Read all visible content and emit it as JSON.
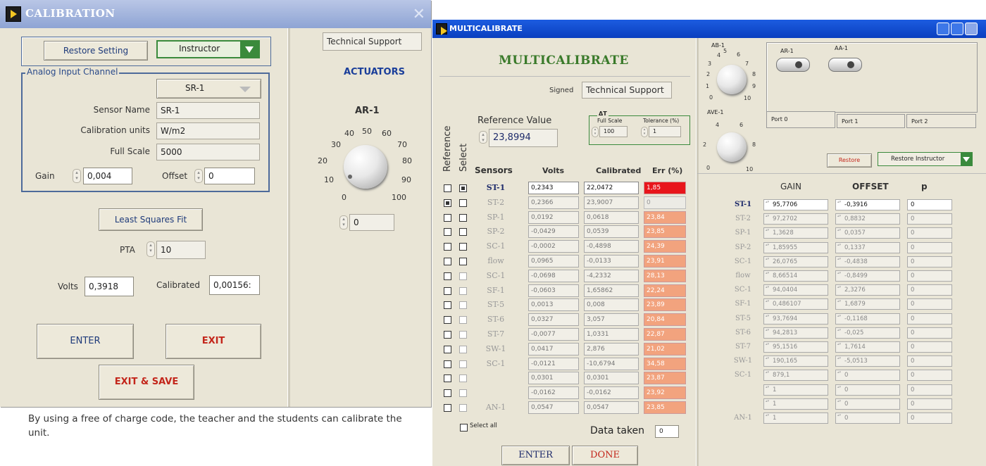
{
  "cal": {
    "title": "CALIBRATION",
    "restore_label": "Restore Setting",
    "instructor_value": "Instructor",
    "group_label": "Analog Input Channel",
    "channel_value": "SR-1",
    "sensor_name_label": "Sensor Name",
    "sensor_name_value": "SR-1",
    "cal_units_label": "Calibration units",
    "cal_units_value": "W/m2",
    "full_scale_label": "Full Scale",
    "full_scale_value": "5000",
    "gain_label": "Gain",
    "gain_value": "0,004",
    "offset_label": "Offset",
    "offset_value": "0",
    "lsq_label": "Least Squares  Fit",
    "pta_label": "PTA",
    "pta_value": "10",
    "volts_label": "Volts",
    "volts_value": "0,3918",
    "calibrated_label": "Calibrated",
    "calibrated_value": "0,00156:",
    "enter_label": "ENTER",
    "exit_label": "EXIT",
    "exit_save_label": "EXIT & SAVE",
    "tech_support_label": "Technical Support",
    "actuators_label": "ACTUATORS",
    "knob_label": "AR-1",
    "knob_ticks": [
      "0",
      "10",
      "20",
      "30",
      "40",
      "50",
      "60",
      "70",
      "80",
      "90",
      "100"
    ],
    "knob_value": "0"
  },
  "caption": "By using a free of charge code, the teacher and the students can calibrate the unit.",
  "multi": {
    "title": "MULTICALIBRATE",
    "heading": "MULTICALIBRATE",
    "signed_label": "Signed",
    "signed_value": "Technical Support",
    "ref_value_label": "Reference Value",
    "ref_value": "23,8994",
    "delta_t_label": "ΔT",
    "full_scale_label": "Full Scale",
    "full_scale_value": "100",
    "tolerance_label": "Tolerance (%)",
    "tolerance_value": "1",
    "col_reference": "Reference",
    "col_select": "Select",
    "col_sensors": "Sensors",
    "col_volts": "Volts",
    "col_calibrated": "Calibrated",
    "col_err": "Err (%)",
    "rows": [
      {
        "name": "ST-1",
        "volts": "0,2343",
        "cal": "22,0472",
        "err": "1,85",
        "ref": false,
        "sel": true,
        "active": true
      },
      {
        "name": "ST-2",
        "volts": "0,2366",
        "cal": "23,9007",
        "err": "0",
        "ref": true,
        "sel": false,
        "active": false
      },
      {
        "name": "SP-1",
        "volts": "0,0192",
        "cal": "0,0618",
        "err": "23,84",
        "ref": false,
        "sel": false,
        "active": false
      },
      {
        "name": "SP-2",
        "volts": "-0,0429",
        "cal": "0,0539",
        "err": "23,85",
        "ref": false,
        "sel": false,
        "active": false
      },
      {
        "name": "SC-1",
        "volts": "-0,0002",
        "cal": "-0,4898",
        "err": "24,39",
        "ref": false,
        "sel": false,
        "active": false
      },
      {
        "name": "flow",
        "volts": "0,0965",
        "cal": "-0,0133",
        "err": "23,91",
        "ref": false,
        "sel": false,
        "active": false
      },
      {
        "name": "SC-1",
        "volts": "-0,0698",
        "cal": "-4,2332",
        "err": "28,13",
        "ref": false,
        "sel": false,
        "active": false
      },
      {
        "name": "SF-1",
        "volts": "-0,0603",
        "cal": "1,65862",
        "err": "22,24",
        "ref": false,
        "sel": false,
        "active": false
      },
      {
        "name": "ST-5",
        "volts": "0,0013",
        "cal": "0,008",
        "err": "23,89",
        "ref": false,
        "sel": false,
        "active": false
      },
      {
        "name": "ST-6",
        "volts": "0,0327",
        "cal": "3,057",
        "err": "20,84",
        "ref": false,
        "sel": false,
        "active": false
      },
      {
        "name": "ST-7",
        "volts": "-0,0077",
        "cal": "1,0331",
        "err": "22,87",
        "ref": false,
        "sel": false,
        "active": false
      },
      {
        "name": "SW-1",
        "volts": "0,0417",
        "cal": "2,876",
        "err": "21,02",
        "ref": false,
        "sel": false,
        "active": false
      },
      {
        "name": "SC-1",
        "volts": "-0,0121",
        "cal": "-10,6794",
        "err": "34,58",
        "ref": false,
        "sel": false,
        "active": false
      },
      {
        "name": "",
        "volts": "0,0301",
        "cal": "0,0301",
        "err": "23,87",
        "ref": false,
        "sel": false,
        "active": false
      },
      {
        "name": "",
        "volts": "-0,0162",
        "cal": "-0,0162",
        "err": "23,92",
        "ref": false,
        "sel": false,
        "active": false
      },
      {
        "name": "AN-1",
        "volts": "0,0547",
        "cal": "0,0547",
        "err": "23,85",
        "ref": false,
        "sel": false,
        "active": false
      }
    ],
    "select_all_label": "Select all",
    "data_taken_label": "Data taken",
    "data_taken_value": "0",
    "enter_label": "ENTER",
    "done_label": "DONE",
    "ab_label": "AB-1",
    "ab_ticks": [
      "0",
      "1",
      "2",
      "3",
      "4",
      "5",
      "6",
      "7",
      "8",
      "9",
      "10"
    ],
    "ave_label": "AVE-1",
    "ave_ticks": [
      "0",
      "2",
      "4",
      "6",
      "8",
      "10"
    ],
    "ar_label": "AR-1",
    "aa_label": "AA-1",
    "ports": [
      "Port 0",
      "Port 1",
      "Port 2"
    ],
    "restore_label": "Restore",
    "restore_instructor_value": "Restore Instructor",
    "gain_header": "GAIN",
    "offset_header": "OFFSET",
    "p_header": "p",
    "grows": [
      {
        "name": "ST-1",
        "gain": "95,7706",
        "offset": "-0,3916",
        "p": "0",
        "active": true
      },
      {
        "name": "ST-2",
        "gain": "97,2702",
        "offset": "0,8832",
        "p": "0",
        "active": false
      },
      {
        "name": "SP-1",
        "gain": "1,3628",
        "offset": "0,0357",
        "p": "0",
        "active": false
      },
      {
        "name": "SP-2",
        "gain": "1,85955",
        "offset": "0,1337",
        "p": "0",
        "active": false
      },
      {
        "name": "SC-1",
        "gain": "26,0765",
        "offset": "-0,4838",
        "p": "0",
        "active": false
      },
      {
        "name": "flow",
        "gain": "8,66514",
        "offset": "-0,8499",
        "p": "0",
        "active": false
      },
      {
        "name": "SC-1",
        "gain": "94,0404",
        "offset": "2,3276",
        "p": "0",
        "active": false
      },
      {
        "name": "SF-1",
        "gain": "0,486107",
        "offset": "1,6879",
        "p": "0",
        "active": false
      },
      {
        "name": "ST-5",
        "gain": "93,7694",
        "offset": "-0,1168",
        "p": "0",
        "active": false
      },
      {
        "name": "ST-6",
        "gain": "94,2813",
        "offset": "-0,025",
        "p": "0",
        "active": false
      },
      {
        "name": "ST-7",
        "gain": "95,1516",
        "offset": "1,7614",
        "p": "0",
        "active": false
      },
      {
        "name": "SW-1",
        "gain": "190,165",
        "offset": "-5,0513",
        "p": "0",
        "active": false
      },
      {
        "name": "SC-1",
        "gain": "879,1",
        "offset": "0",
        "p": "0",
        "active": false
      },
      {
        "name": "",
        "gain": "1",
        "offset": "0",
        "p": "0",
        "active": false
      },
      {
        "name": "",
        "gain": "1",
        "offset": "0",
        "p": "0",
        "active": false
      },
      {
        "name": "AN-1",
        "gain": "1",
        "offset": "0",
        "p": "0",
        "active": false
      }
    ]
  }
}
